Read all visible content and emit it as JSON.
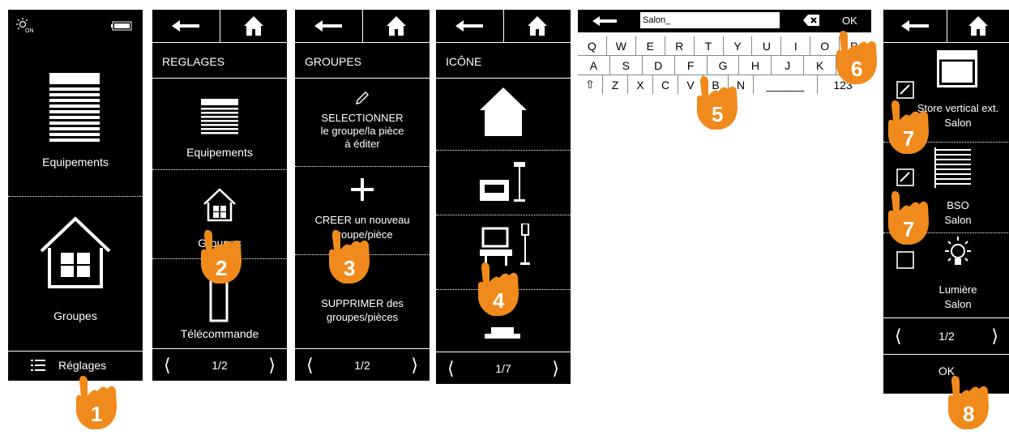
{
  "accent": "#f08a1c",
  "screen1": {
    "status_icon": "sun-on-icon",
    "battery_icon": "battery-icon",
    "items": [
      {
        "label": "Equipements",
        "icon": "blind-icon"
      },
      {
        "label": "Groupes",
        "icon": "house-icon"
      }
    ],
    "settings_label": "Réglages"
  },
  "screen2": {
    "title": "REGLAGES",
    "items": [
      {
        "label": "Equipements"
      },
      {
        "label": "Groupes"
      },
      {
        "label": "Télécommande"
      }
    ],
    "page": "1/2"
  },
  "screen3": {
    "title": "GROUPES",
    "select_lines": [
      "SELECTIONNER",
      "le groupe/la pièce",
      "à éditer"
    ],
    "create_lines": [
      "CREER un nouveau",
      "groupe/pièce"
    ],
    "delete_lines": [
      "SUPPRIMER des",
      "groupes/pièces"
    ],
    "page": "1/2"
  },
  "screen4": {
    "title": "ICÔNE",
    "page": "1/7"
  },
  "keyboard": {
    "input_value": "Salon_",
    "ok_label": "OK",
    "row1": [
      "Q",
      "W",
      "E",
      "R",
      "T",
      "Y",
      "U",
      "I",
      "O",
      "P"
    ],
    "row2": [
      "A",
      "S",
      "D",
      "F",
      "G",
      "H",
      "J",
      "K",
      "L"
    ],
    "row3": [
      "Z",
      "X",
      "C",
      "V",
      "B",
      "N"
    ],
    "num_label": "123"
  },
  "screen6": {
    "items": [
      {
        "lines": [
          "Store vertical ext.",
          "Salon"
        ],
        "checked": true
      },
      {
        "lines": [
          "BSO",
          "Salon"
        ],
        "checked": true
      },
      {
        "lines": [
          "Lumière",
          "Salon"
        ],
        "checked": false
      }
    ],
    "page": "1/2",
    "ok_label": "OK"
  },
  "steps": [
    "1",
    "2",
    "3",
    "4",
    "5",
    "6",
    "7",
    "7",
    "8"
  ]
}
